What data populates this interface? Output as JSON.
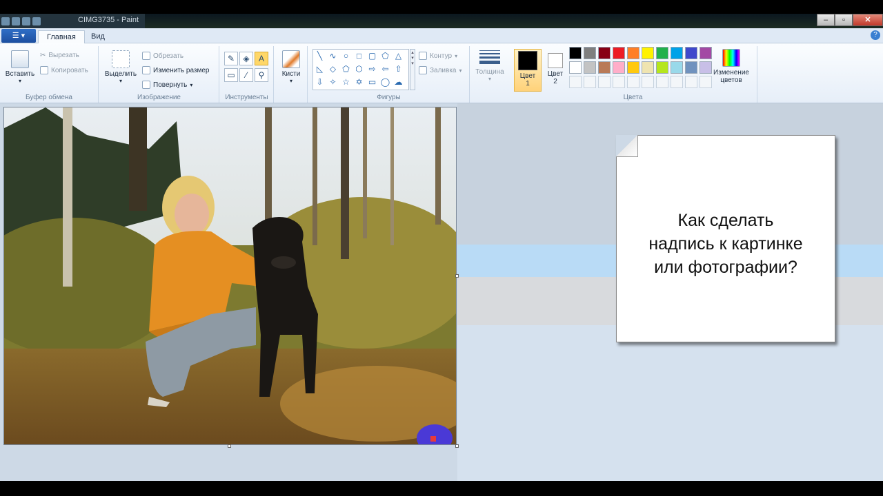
{
  "window": {
    "title": "CIMG3735 - Paint"
  },
  "tabs": {
    "home": "Главная",
    "view": "Вид"
  },
  "clipboard": {
    "paste": "Вставить",
    "cut": "Вырезать",
    "copy": "Копировать",
    "label": "Буфер обмена"
  },
  "image": {
    "select": "Выделить",
    "crop": "Обрезать",
    "resize": "Изменить размер",
    "rotate": "Повернуть",
    "label": "Изображение"
  },
  "tools": {
    "label": "Инструменты"
  },
  "brushes": {
    "label": "Кисти"
  },
  "shapes": {
    "outline": "Контур",
    "fill": "Заливка",
    "label": "Фигуры"
  },
  "size": {
    "label": "Толщина"
  },
  "colors": {
    "color1_label": "Цвет",
    "color1_num": "1",
    "color2_label": "Цвет",
    "color2_num": "2",
    "edit_line1": "Изменение",
    "edit_line2": "цветов",
    "label": "Цвета",
    "color1_value": "#000000",
    "color2_value": "#ffffff",
    "palette": [
      "#000000",
      "#7f7f7f",
      "#880015",
      "#ed1c24",
      "#ff7f27",
      "#fff200",
      "#22b14c",
      "#00a2e8",
      "#3f48cc",
      "#a349a4",
      "#ffffff",
      "#c3c3c3",
      "#b97a57",
      "#ffaec9",
      "#ffc90e",
      "#efe4b0",
      "#b5e61d",
      "#99d9ea",
      "#7092be",
      "#c8bfe7"
    ]
  },
  "note": {
    "line1": "Как сделать",
    "line2": "надпись к картинке",
    "line3": "или фотографии?"
  }
}
